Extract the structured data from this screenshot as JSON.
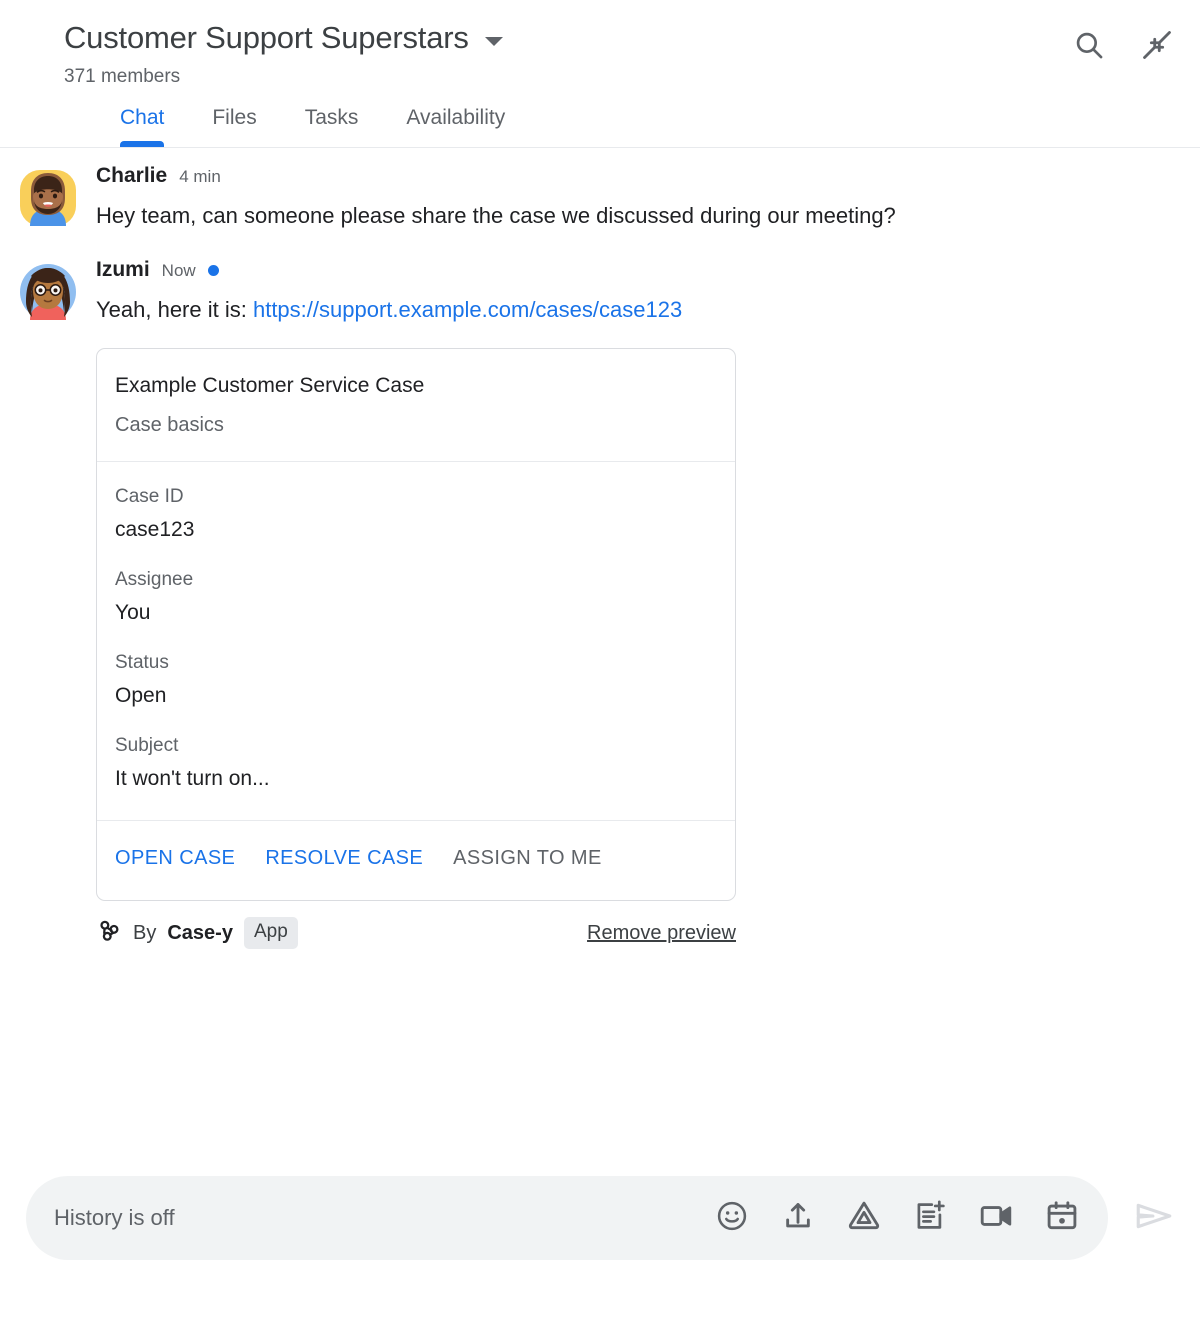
{
  "header": {
    "title": "Customer Support Superstars",
    "members": "371 members",
    "dropdown_icon": "chevron-down-icon",
    "search_icon": "search-icon",
    "collapse_icon": "collapse-icon"
  },
  "tabs": [
    {
      "label": "Chat",
      "active": true
    },
    {
      "label": "Files",
      "active": false
    },
    {
      "label": "Tasks",
      "active": false
    },
    {
      "label": "Availability",
      "active": false
    }
  ],
  "messages": [
    {
      "sender": "Charlie",
      "time": "4 min",
      "unread": false,
      "text": "Hey team, can someone please share the case we discussed during our meeting?"
    },
    {
      "sender": "Izumi",
      "time": "Now",
      "unread": true,
      "text_prefix": "Yeah, here it is: ",
      "link": "https://support.example.com/cases/case123"
    }
  ],
  "card": {
    "title": "Example Customer Service Case",
    "subtitle": "Case basics",
    "fields": [
      {
        "label": "Case ID",
        "value": "case123"
      },
      {
        "label": "Assignee",
        "value": "You"
      },
      {
        "label": "Status",
        "value": "Open"
      },
      {
        "label": "Subject",
        "value": "It won't turn on..."
      }
    ],
    "actions": [
      {
        "label": "OPEN CASE",
        "muted": false
      },
      {
        "label": "RESOLVE CASE",
        "muted": false
      },
      {
        "label": "ASSIGN TO ME",
        "muted": true
      }
    ],
    "footer": {
      "by_prefix": "By ",
      "app_name": "Case-y",
      "app_badge": "App",
      "bot_icon": "webhook-icon",
      "remove_preview": "Remove preview"
    }
  },
  "composer": {
    "placeholder": "History is off",
    "icons": [
      "emoji-icon",
      "upload-icon",
      "google-drive-icon",
      "add-task-icon",
      "video-meeting-icon",
      "calendar-icon"
    ],
    "send_icon": "send-icon"
  },
  "colors": {
    "accent": "#1a73e8",
    "text_primary": "#202124",
    "text_secondary": "#5f6368",
    "divider": "#e8eaed",
    "card_border": "#dadce0",
    "composer_bg": "#f1f3f4",
    "badge_bg": "#e8eaed",
    "send_disabled": "#dadce0"
  }
}
